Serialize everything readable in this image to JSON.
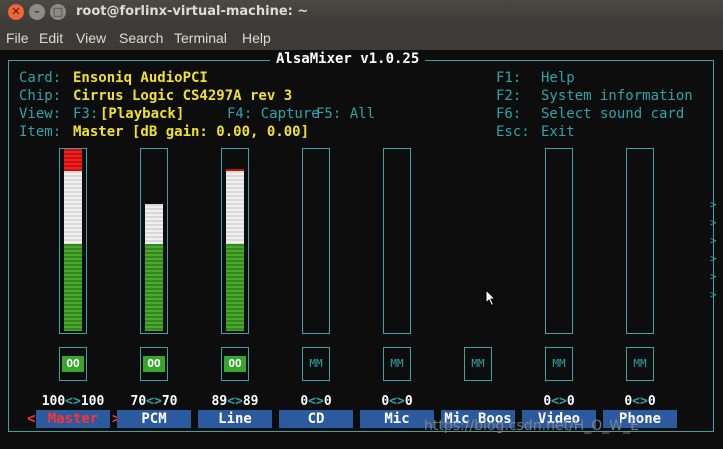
{
  "window": {
    "title": "root@forlinx-virtual-machine: ~",
    "close_glyph": "✕",
    "min_glyph": "–",
    "max_glyph": "□"
  },
  "menu": [
    "File",
    "Edit",
    "View",
    "Search",
    "Terminal",
    "Help"
  ],
  "mixer": {
    "title": "AlsaMixer v1.0.25",
    "card_label": "Card:",
    "card_value": "Ensoniq AudioPCI",
    "chip_label": "Chip:",
    "chip_value": "Cirrus Logic CS4297A rev 3",
    "view_label": "View:",
    "view_f3": "F3:",
    "view_playback": "[Playback]",
    "view_f4": "F4: Capture",
    "view_f5": "F5: All",
    "item_label": "Item:",
    "item_value": "Master [dB gain: 0.00, 0.00]",
    "keys": [
      {
        "key": "F1:",
        "action": "Help"
      },
      {
        "key": "F2:",
        "action": "System information"
      },
      {
        "key": "F6:",
        "action": "Select sound card"
      },
      {
        "key": "Esc:",
        "action": "Exit"
      }
    ],
    "more_arrow": ">",
    "channels": [
      {
        "name": "Master",
        "level": 100,
        "volume": "100<>100",
        "left": "100",
        "right": "100",
        "mute": "OO",
        "selected": true
      },
      {
        "name": "PCM",
        "level": 70,
        "volume": "70<>70",
        "left": "70",
        "right": "70",
        "mute": "OO",
        "selected": false
      },
      {
        "name": "Line",
        "level": 89,
        "volume": "89<>89",
        "left": "89",
        "right": "89",
        "mute": "OO",
        "selected": false
      },
      {
        "name": "CD",
        "level": 0,
        "volume": "0<>0",
        "left": "0",
        "right": "0",
        "mute": "MM",
        "selected": false
      },
      {
        "name": "Mic",
        "level": 0,
        "volume": "0<>0",
        "left": "0",
        "right": "0",
        "mute": "MM",
        "selected": false
      },
      {
        "name": "Mic Boos",
        "level": null,
        "volume": "",
        "left": "",
        "right": "",
        "mute": "MM",
        "selected": false
      },
      {
        "name": "Video",
        "level": 0,
        "volume": "0<>0",
        "left": "0",
        "right": "0",
        "mute": "MM",
        "selected": false
      },
      {
        "name": "Phone",
        "level": 0,
        "volume": "0<>0",
        "left": "0",
        "right": "0",
        "mute": "MM",
        "selected": false
      }
    ],
    "sel_left": "<",
    "sel_right": ">"
  },
  "watermark": "https://blog.csdn.net/H_O_W_E"
}
